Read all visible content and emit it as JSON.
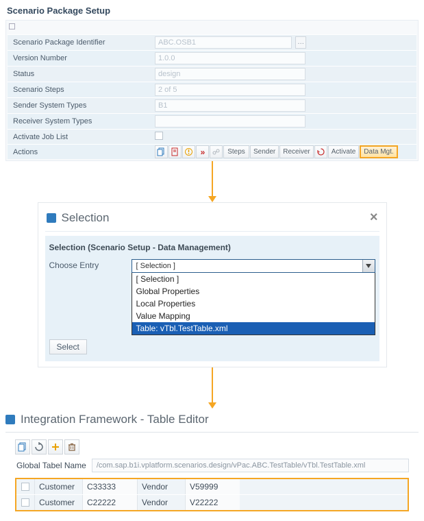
{
  "setup": {
    "title": "Scenario Package Setup",
    "fields": {
      "identifier_label": "Scenario Package Identifier",
      "identifier_value": "ABC.OSB1",
      "version_label": "Version Number",
      "version_value": "1.0.0",
      "status_label": "Status",
      "status_value": "design",
      "steps_label": "Scenario Steps",
      "steps_value": "2 of 5",
      "sender_label": "Sender System Types",
      "sender_value": "B1",
      "receiver_label": "Receiver System Types",
      "receiver_value": "",
      "joblist_label": "Activate Job List",
      "actions_label": "Actions"
    },
    "actions": {
      "steps": "Steps",
      "sender": "Sender",
      "receiver": "Receiver",
      "activate": "Activate",
      "data_mgt": "Data Mgt."
    }
  },
  "selection": {
    "title": "Selection",
    "subtitle": "Selection (Scenario Setup - Data Management)",
    "choose_label": "Choose Entry",
    "current": "[ Selection ]",
    "options": [
      "[ Selection ]",
      "Global Properties",
      "Local Properties",
      "Value Mapping",
      "Table: vTbl.TestTable.xml"
    ],
    "select_btn": "Select"
  },
  "editor": {
    "title": "Integration Framework - Table Editor",
    "global_table_label": "Global Tabel Name",
    "global_table_value": "/com.sap.b1i.vplatform.scenarios.design/vPac.ABC.TestTable/vTbl.TestTable.xml",
    "rows": [
      {
        "col1_label": "Customer",
        "col1_value": "C33333",
        "col2_label": "Vendor",
        "col2_value": "V59999"
      },
      {
        "col1_label": "Customer",
        "col1_value": "C22222",
        "col2_label": "Vendor",
        "col2_value": "V22222"
      }
    ]
  }
}
